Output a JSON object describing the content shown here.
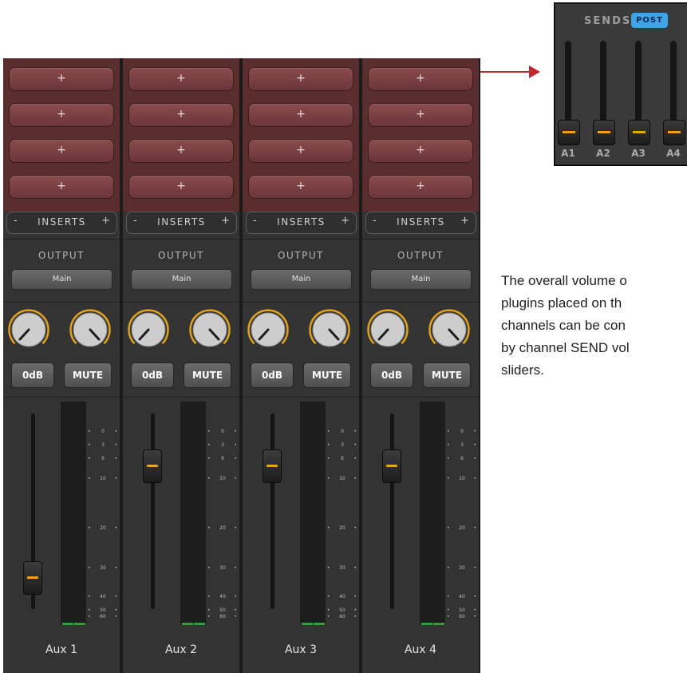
{
  "inserts": {
    "slot_label": "+",
    "minus": "-",
    "label": "INSERTS",
    "plus": "+"
  },
  "output": {
    "label": "OUTPUT",
    "button": "Main"
  },
  "buttons": {
    "odb": "0dB",
    "mute": "MUTE"
  },
  "meter_scale": [
    "0",
    "3",
    "6",
    "10",
    "20",
    "30",
    "40",
    "50",
    "60"
  ],
  "strips": [
    {
      "name": "Aux 1",
      "fader_level": 0.1
    },
    {
      "name": "Aux 2",
      "fader_level": 0.78
    },
    {
      "name": "Aux 3",
      "fader_level": 0.78
    },
    {
      "name": "Aux 4",
      "fader_level": 0.78
    }
  ],
  "sends": {
    "title": "SENDS",
    "mode_button": "POST",
    "mode_color": "#3fa3e8",
    "labels": [
      "A1",
      "A2",
      "A3",
      "A4"
    ],
    "levels": [
      0,
      0,
      0,
      0
    ]
  },
  "caption": {
    "lines": [
      "The overall volume o",
      "plugins placed on th",
      "channels can be con",
      "by channel SEND vol",
      "sliders."
    ]
  },
  "colors": {
    "accent": "#f1a20d",
    "insert_area": "#5a2e2f",
    "arrow": "#c0282d",
    "meter_signal": "#3d9a3a"
  }
}
